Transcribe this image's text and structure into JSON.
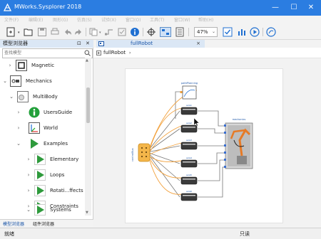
{
  "window": {
    "title": "MWorks.Sysplorer 2018",
    "controls": {
      "minimize": "—",
      "maximize": "☐",
      "close": "✕"
    }
  },
  "menu": {
    "items": [
      "文件(F)",
      "编辑(E)",
      "图形(G)",
      "仿真(S)",
      "试验(X)",
      "窗口(O)",
      "工具(T)",
      "窗口(W)",
      "帮助(H)"
    ]
  },
  "toolbar": {
    "zoom": "47%"
  },
  "model_browser": {
    "title": "模型浏览器",
    "pin": "⊡",
    "close": "✕",
    "search_placeholder": "查找模型",
    "tree": [
      {
        "label": "Magnetic",
        "chevron": "›",
        "icon": "magnetic-icon"
      },
      {
        "label": "Mechanics",
        "chevron": "⌄",
        "icon": "mechanics-icon"
      },
      {
        "label": "MultiBody",
        "chevron": "⌄",
        "icon": "multibody-icon"
      },
      {
        "label": "UsersGuide",
        "chevron": "›",
        "icon": "info-icon"
      },
      {
        "label": "World",
        "chevron": "›",
        "icon": "world-icon"
      },
      {
        "label": "Examples",
        "chevron": "⌄",
        "icon": "play-icon"
      },
      {
        "label": "Elementary",
        "chevron": "›",
        "icon": "play-icon"
      },
      {
        "label": "Loops",
        "chevron": "›",
        "icon": "play-icon"
      },
      {
        "label": "Rotati...ffects",
        "chevron": "›",
        "icon": "play-icon"
      },
      {
        "label": "Constraints",
        "chevron": "›",
        "icon": "play-icon"
      },
      {
        "label": "Systems",
        "chevron": "⌄",
        "icon": "play-icon"
      }
    ],
    "bottom_tabs": [
      "模型浏览器",
      "组件浏览器"
    ]
  },
  "document": {
    "tab_label": "fullRobot",
    "tab_close": "×",
    "breadcrumb": "fullRobot",
    "breadcrumb_sep": "›",
    "diagram": {
      "source_label": "controlBus",
      "sink_label": "mechanics",
      "top_block_label": "pathPlanning",
      "axis_labels": [
        "axis1",
        "axis2",
        "axis3",
        "axis4",
        "axis5",
        "axis6"
      ]
    }
  },
  "status": {
    "left": "就绪",
    "center": "只读"
  },
  "colors": {
    "titlebar": "#2b7de1",
    "tree_play": "#2e9a3c",
    "info": "#22a03a",
    "connector_orange": "#f2a03a",
    "robot_orange": "#e67a26"
  }
}
